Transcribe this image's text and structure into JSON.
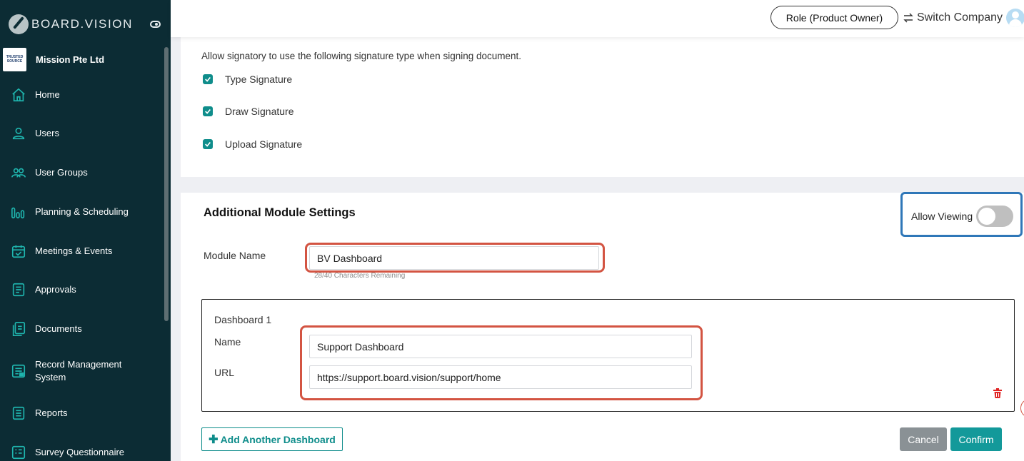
{
  "brand": {
    "name": "BOARD.VISION"
  },
  "company": {
    "name": "Mission Pte Ltd",
    "logo_line1": "TRUSTED",
    "logo_line2": "SOURCE"
  },
  "sidebar": {
    "items": [
      {
        "label": "Home",
        "icon": "home-icon"
      },
      {
        "label": "Users",
        "icon": "user-icon"
      },
      {
        "label": "User Groups",
        "icon": "users-icon"
      },
      {
        "label": "Planning & Scheduling",
        "icon": "bar-chart-icon"
      },
      {
        "label": "Meetings & Events",
        "icon": "calendar-icon"
      },
      {
        "label": "Approvals",
        "icon": "approvals-icon"
      },
      {
        "label": "Documents",
        "icon": "documents-icon"
      },
      {
        "label": "Record Management System",
        "icon": "record-icon"
      },
      {
        "label": "Reports",
        "icon": "reports-icon"
      },
      {
        "label": "Survey Questionnaire",
        "icon": "survey-icon"
      }
    ]
  },
  "header": {
    "role": "Role (Product Owner)",
    "switch_company": "Switch Company"
  },
  "signature_settings": {
    "description": "Allow signatory to use the following signature type when signing document.",
    "options": [
      {
        "label": "Type Signature",
        "checked": true
      },
      {
        "label": "Draw Signature",
        "checked": true
      },
      {
        "label": "Upload Signature",
        "checked": true
      }
    ]
  },
  "module_settings": {
    "title": "Additional Module Settings",
    "allow_viewing_label": "Allow Viewing",
    "allow_viewing": false,
    "module_name_label": "Module Name",
    "module_name_value": "BV Dashboard",
    "chars_remaining": "28/40 Characters Remaining",
    "dashboards": [
      {
        "title": "Dashboard 1",
        "name_label": "Name",
        "name_value": "Support Dashboard",
        "url_label": "URL",
        "url_value": "https://support.board.vision/support/home"
      }
    ],
    "add_dashboard": "Add Another Dashboard",
    "cancel": "Cancel",
    "confirm": "Confirm"
  },
  "colors": {
    "sidebar": "#0c2c34",
    "accent": "#13999a",
    "highlight_red": "#d35442",
    "highlight_blue": "#2f77b8"
  }
}
